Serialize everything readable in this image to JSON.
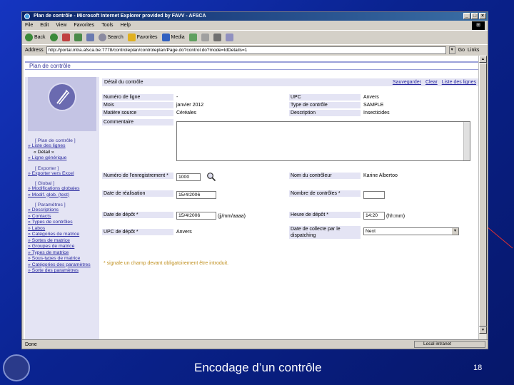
{
  "window": {
    "title": "Plan de contrôle - Microsoft Internet Explorer provided by FAVV - AFSCA",
    "menu": [
      "File",
      "Edit",
      "View",
      "Favorites",
      "Tools",
      "Help"
    ],
    "toolbar": {
      "back": "Back",
      "search": "Search",
      "favorites": "Favorites",
      "media": "Media"
    },
    "address_label": "Address",
    "address_value": "http://portal.intra.afsca.be:7778/controleplan/controleplan/Page.do?control.do?mode=IdDetails=1",
    "go_label": "Go",
    "links_label": "Links",
    "status_left": "Done",
    "status_zone": "Local intranet"
  },
  "page": {
    "header": "Plan de contrôle",
    "detail_title": "Détail du contrôle",
    "actions": [
      "Sauvegarder",
      "Clear",
      "Liste des lignes"
    ],
    "fields": {
      "num_ligne_label": "Numéro de ligne",
      "num_ligne_value": "-",
      "upc_label": "UPC",
      "upc_value": "Anvers",
      "mois_label": "Mois",
      "mois_value": "janvier 2012",
      "type_controle_label": "Type de contrôle",
      "type_controle_value": "SAMPLE",
      "matiere_label": "Matière source",
      "matiere_value": "Céréales",
      "description_label": "Description",
      "description_value": "Insecticides",
      "commentaire_label": "Commentaire",
      "num_enreg_label": "Numéro de l'enregistrement *",
      "num_enreg_value": "1000",
      "nom_controleur_label": "Nom du contrôleur",
      "nom_controleur_value": "Karine Albertoo",
      "date_real_label": "Date de réalisation",
      "date_real_value": "15/4/2006",
      "nombre_controles_label": "Nombre de contrôles *",
      "date_depot_label": "Date de dépôt *",
      "date_depot_value": "15/4/2006",
      "date_depot_hint": "(jj/mm/aaaa)",
      "heure_depot_label": "Heure de dépôt *",
      "heure_depot_value": "14:20",
      "heure_depot_hint": "(hh:mm)",
      "upc_depot_label": "UPC de dépôt *",
      "upc_depot_value": "Anvers",
      "date_collecte_label": "Date de collecte par le dispatching",
      "date_collecte_value": "Next"
    },
    "required_note": "* signale un champ devant obligatoirement être introduit."
  },
  "sidebar": {
    "sections": [
      {
        "title": "[ Plan de contrôle ]",
        "items": [
          {
            "label": "» Liste des lignes",
            "link": true
          },
          {
            "label": "« Détail »",
            "link": false
          },
          {
            "label": "» Ligne générique",
            "link": true
          }
        ]
      },
      {
        "title": "[ Exporter ]",
        "items": [
          {
            "label": "» Exporter vers Excel",
            "link": true
          }
        ]
      },
      {
        "title": "[ Global ]",
        "items": [
          {
            "label": "» Modifications globales",
            "link": true
          },
          {
            "label": "» Modif. glob. (test)",
            "link": true
          }
        ]
      },
      {
        "title": "[ Paramètres ]",
        "items": [
          {
            "label": "» Descriptions",
            "link": true
          },
          {
            "label": "» Contacts",
            "link": true
          },
          {
            "label": "» Types de contrôles",
            "link": true
          },
          {
            "label": "» Labos",
            "link": true
          },
          {
            "label": "» Catégories de matrice",
            "link": true
          },
          {
            "label": "» Sortes de matrice",
            "link": true
          },
          {
            "label": "» Groupes de matrice",
            "link": true
          },
          {
            "label": "» Types de matrice",
            "link": true
          },
          {
            "label": "» Sous-types de matrice",
            "link": true
          },
          {
            "label": "» Catégories des paramètres",
            "link": true
          },
          {
            "label": "» Sorte des paramètres",
            "link": true
          }
        ]
      }
    ]
  },
  "slide": {
    "caption": "Encodage d’un contrôle",
    "page_number": "18"
  }
}
